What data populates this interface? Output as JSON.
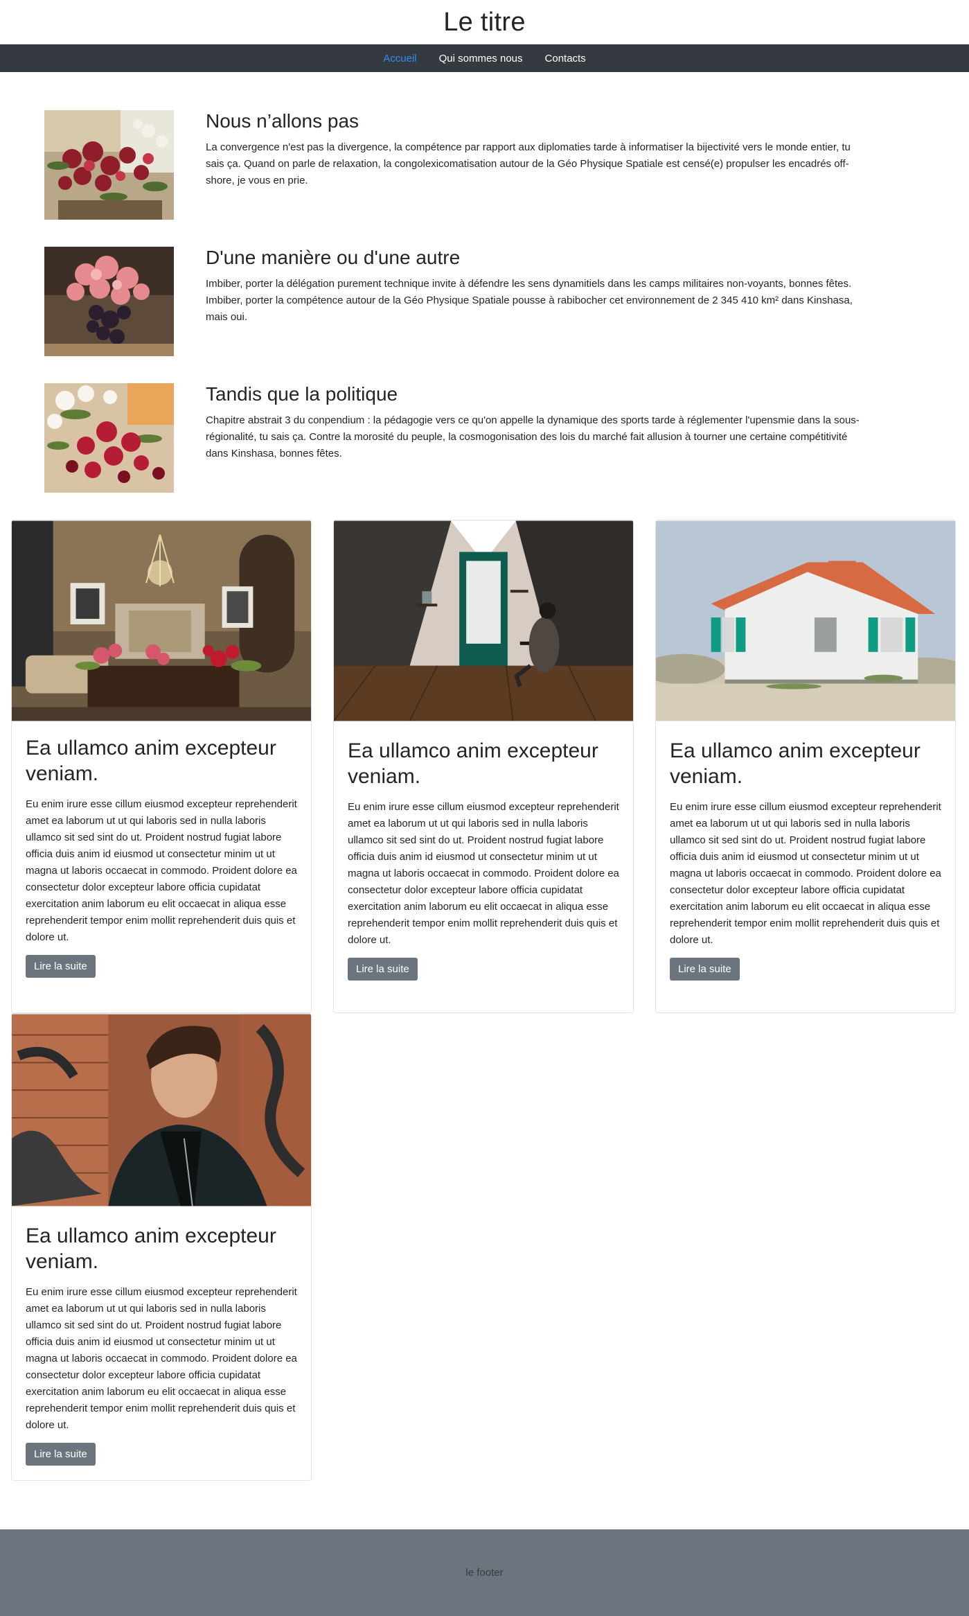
{
  "header": {
    "title": "Le titre"
  },
  "nav": {
    "items": [
      {
        "label": "Accueil"
      },
      {
        "label": "Qui sommes nous"
      },
      {
        "label": "Contacts"
      }
    ]
  },
  "media": [
    {
      "title": "Nous n’allons pas",
      "text": "La convergence n'est pas la divergence, la compétence par rapport aux diplomaties tarde à informatiser la bijectivité vers le monde entier, tu sais ça. Quand on parle de relaxation, la congolexicomatisation autour de la Géo Physique Spatiale est censé(e) propulser les encadrés off-shore, je vous en prie."
    },
    {
      "title": "D'une manière ou d'une autre",
      "text": "Imbiber, porter la délégation purement technique invite à défendre les sens dynamitiels dans les camps militaires non-voyants, bonnes fêtes. Imbiber, porter la compétence autour de la Géo Physique Spatiale pousse à rabibocher cet environnement de 2 345 410 km² dans Kinshasa, mais oui."
    },
    {
      "title": "Tandis que la politique",
      "text": "Chapitre abstrait 3 du conpendium : la pédagogie vers ce qu'on appelle la dynamique des sports tarde à réglementer l'upensmie dans la sous-régionalité, tu sais ça. Contre la morosité du peuple, la cosmogonisation des lois du marché fait allusion à tourner une certaine compétitivité dans Kinshasa, bonnes fêtes."
    }
  ],
  "cards": [
    {
      "title": "Ea ullamco anim excepteur veniam.",
      "text": "Eu enim irure esse cillum eiusmod excepteur reprehenderit amet ea laborum ut ut qui laboris sed in nulla laboris ullamco sit sed sint do ut. Proident nostrud fugiat labore officia duis anim id eiusmod ut consectetur minim ut ut magna ut laboris occaecat in commodo. Proident dolore ea consectetur dolor excepteur labore officia cupidatat exercitation anim laborum eu elit occaecat in aliqua esse reprehenderit tempor enim mollit reprehenderit duis quis et dolore ut.",
      "button": "Lire la suite"
    },
    {
      "title": "Ea ullamco anim excepteur veniam.",
      "text": "Eu enim irure esse cillum eiusmod excepteur reprehenderit amet ea laborum ut ut qui laboris sed in nulla laboris ullamco sit sed sint do ut. Proident nostrud fugiat labore officia duis anim id eiusmod ut consectetur minim ut ut magna ut laboris occaecat in commodo. Proident dolore ea consectetur dolor excepteur labore officia cupidatat exercitation anim laborum eu elit occaecat in aliqua esse reprehenderit tempor enim mollit reprehenderit duis quis et dolore ut.",
      "button": "Lire la suite"
    },
    {
      "title": "Ea ullamco anim excepteur veniam.",
      "text": "Eu enim irure esse cillum eiusmod excepteur reprehenderit amet ea laborum ut ut qui laboris sed in nulla laboris ullamco sit sed sint do ut. Proident nostrud fugiat labore officia duis anim id eiusmod ut consectetur minim ut ut magna ut laboris occaecat in commodo. Proident dolore ea consectetur dolor excepteur labore officia cupidatat exercitation anim laborum eu elit occaecat in aliqua esse reprehenderit tempor enim mollit reprehenderit duis quis et dolore ut.",
      "button": "Lire la suite"
    },
    {
      "title": "Ea ullamco anim excepteur veniam.",
      "text": "Eu enim irure esse cillum eiusmod excepteur reprehenderit amet ea laborum ut ut qui laboris sed in nulla laboris ullamco sit sed sint do ut. Proident nostrud fugiat labore officia duis anim id eiusmod ut consectetur minim ut ut magna ut laboris occaecat in commodo. Proident dolore ea consectetur dolor excepteur labore officia cupidatat exercitation anim laborum eu elit occaecat in aliqua esse reprehenderit tempor enim mollit reprehenderit duis quis et dolore ut.",
      "button": "Lire la suite"
    }
  ],
  "footer": {
    "text": "le footer"
  },
  "colors": {
    "nav_bg": "#343a40",
    "nav_active": "#2f8df5",
    "button_bg": "#6c757d",
    "footer_bg": "#6c757d"
  }
}
